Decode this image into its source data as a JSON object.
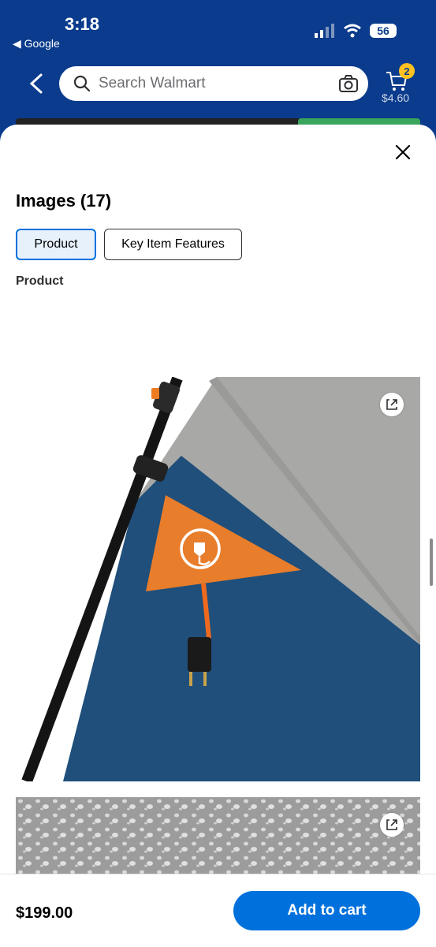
{
  "status_bar": {
    "time": "3:18",
    "back_app": "◀ Google",
    "battery": "56"
  },
  "nav": {
    "search_placeholder": "Search Walmart",
    "cart_count": "2",
    "cart_total": "$4.60"
  },
  "sheet": {
    "title": "Images (17)",
    "tabs": [
      {
        "label": "Product",
        "selected": true
      },
      {
        "label": "Key Item Features",
        "selected": false
      }
    ],
    "section_label": "Product",
    "images": [
      {
        "name": "tent-electrical-port"
      },
      {
        "name": "water-droplets-fabric"
      }
    ]
  },
  "footer": {
    "price": "$199.00",
    "add_to_cart": "Add to cart"
  },
  "colors": {
    "walmart_blue": "#0a3b8c",
    "button_blue": "#0071dc",
    "cart_badge": "#ffc220"
  },
  "icons": [
    "search-icon",
    "camera-icon",
    "cart-icon",
    "close-icon",
    "expand-icon",
    "back-chevron-icon",
    "wifi-icon",
    "signal-icon",
    "battery-icon"
  ]
}
